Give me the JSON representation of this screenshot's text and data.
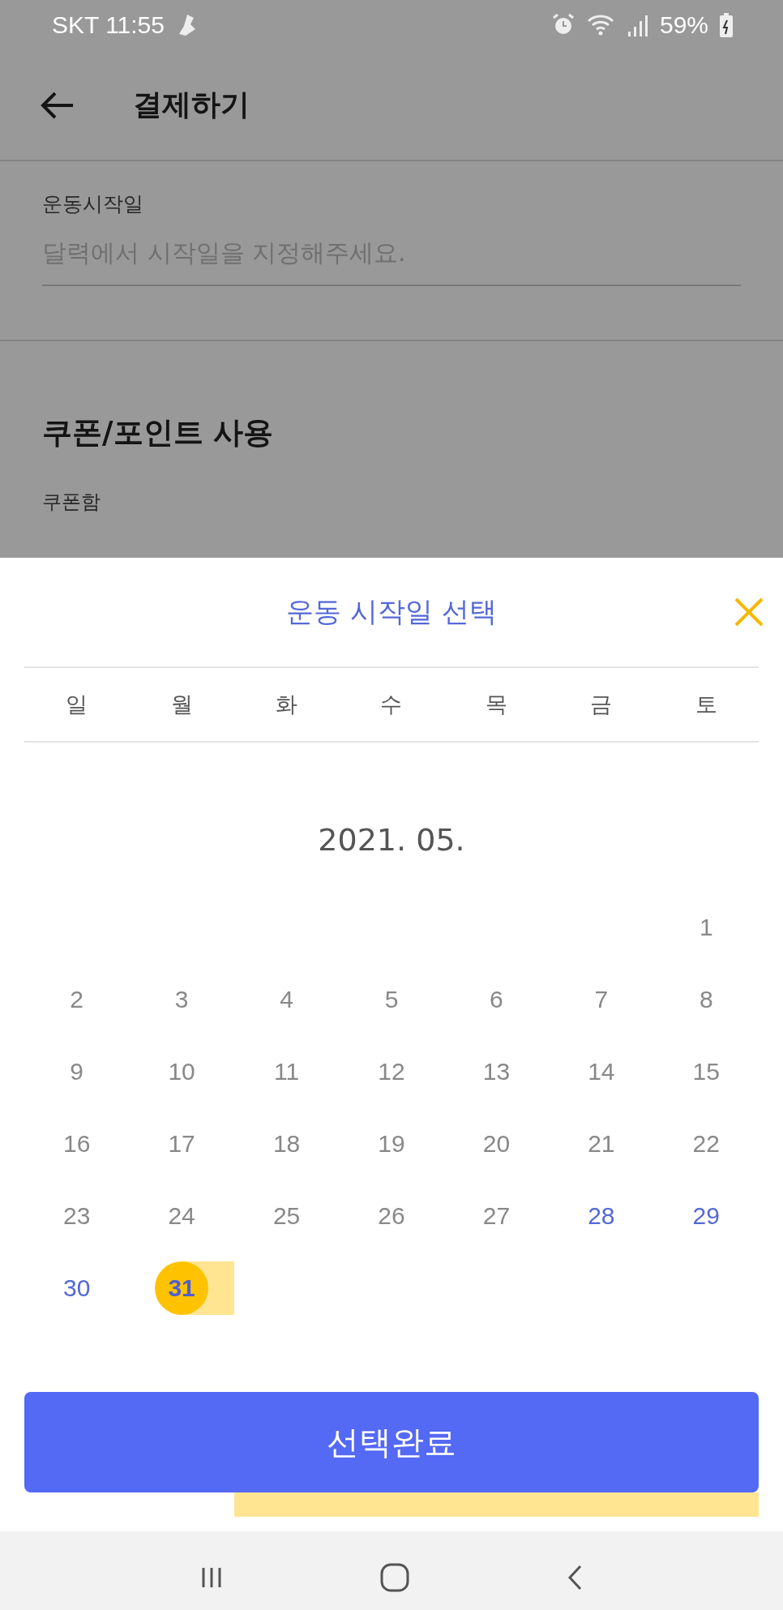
{
  "status_bar": {
    "carrier_time": "SKT 11:55",
    "battery": "59%"
  },
  "header": {
    "title": "결제하기"
  },
  "form": {
    "start_date": {
      "label": "운동시작일",
      "placeholder": "달력에서 시작일을 지정해주세요."
    },
    "coupon_section": {
      "title": "쿠폰/포인트 사용",
      "coupon_label": "쿠폰함"
    }
  },
  "sheet": {
    "title": "운동 시작일 선택",
    "weekdays": [
      "일",
      "월",
      "화",
      "수",
      "목",
      "금",
      "토"
    ],
    "month": "2021. 05.",
    "weeks": [
      [
        {
          "kind": "blank"
        },
        {
          "kind": "blank"
        },
        {
          "kind": "blank"
        },
        {
          "kind": "blank"
        },
        {
          "kind": "blank"
        },
        {
          "kind": "blank"
        },
        {
          "kind": "day",
          "label": "1",
          "available": false,
          "selected": false,
          "in_range": false
        }
      ],
      [
        {
          "label": "2",
          "available": false,
          "selected": false,
          "in_range": false
        },
        {
          "label": "3",
          "available": false,
          "selected": false,
          "in_range": false
        },
        {
          "label": "4",
          "available": false,
          "selected": false,
          "in_range": false
        },
        {
          "label": "5",
          "available": false,
          "selected": false,
          "in_range": false
        },
        {
          "label": "6",
          "available": false,
          "selected": false,
          "in_range": false
        },
        {
          "label": "7",
          "available": false,
          "selected": false,
          "in_range": false
        },
        {
          "label": "8",
          "available": false,
          "selected": false,
          "in_range": false
        }
      ],
      [
        {
          "label": "9",
          "available": false,
          "selected": false,
          "in_range": false
        },
        {
          "label": "10",
          "available": false,
          "selected": false,
          "in_range": false
        },
        {
          "label": "11",
          "available": false,
          "selected": false,
          "in_range": false
        },
        {
          "label": "12",
          "available": false,
          "selected": false,
          "in_range": false
        },
        {
          "label": "13",
          "available": false,
          "selected": false,
          "in_range": false
        },
        {
          "label": "14",
          "available": false,
          "selected": false,
          "in_range": false
        },
        {
          "label": "15",
          "available": false,
          "selected": false,
          "in_range": false
        }
      ],
      [
        {
          "label": "16",
          "available": false,
          "selected": false,
          "in_range": false
        },
        {
          "label": "17",
          "available": false,
          "selected": false,
          "in_range": false
        },
        {
          "label": "18",
          "available": false,
          "selected": false,
          "in_range": false
        },
        {
          "label": "19",
          "available": false,
          "selected": false,
          "in_range": false
        },
        {
          "label": "20",
          "available": false,
          "selected": false,
          "in_range": false
        },
        {
          "label": "21",
          "available": false,
          "selected": false,
          "in_range": false
        },
        {
          "label": "22",
          "available": false,
          "selected": false,
          "in_range": false
        }
      ],
      [
        {
          "label": "23",
          "available": false,
          "selected": false,
          "in_range": false
        },
        {
          "label": "24",
          "available": false,
          "selected": false,
          "in_range": false
        },
        {
          "label": "25",
          "available": false,
          "selected": false,
          "in_range": false
        },
        {
          "label": "26",
          "available": false,
          "selected": false,
          "in_range": false
        },
        {
          "label": "27",
          "available": false,
          "selected": false,
          "in_range": false
        },
        {
          "label": "28",
          "available": true,
          "selected": false,
          "in_range": false
        },
        {
          "label": "29",
          "available": true,
          "selected": false,
          "in_range": false
        }
      ],
      [
        {
          "label": "30",
          "available": true,
          "selected": false,
          "in_range": false
        },
        {
          "label": "31",
          "available": true,
          "selected": true,
          "in_range": true
        },
        {
          "kind": "blank"
        },
        {
          "kind": "blank"
        },
        {
          "kind": "blank"
        },
        {
          "kind": "blank"
        },
        {
          "kind": "blank"
        }
      ]
    ],
    "covered_week": [
      {
        "in_range": false
      },
      {
        "in_range": false
      },
      {
        "in_range": true
      },
      {
        "in_range": true
      },
      {
        "in_range": true
      },
      {
        "in_range": true
      },
      {
        "in_range": true
      }
    ],
    "confirm_button": "선택완료"
  }
}
